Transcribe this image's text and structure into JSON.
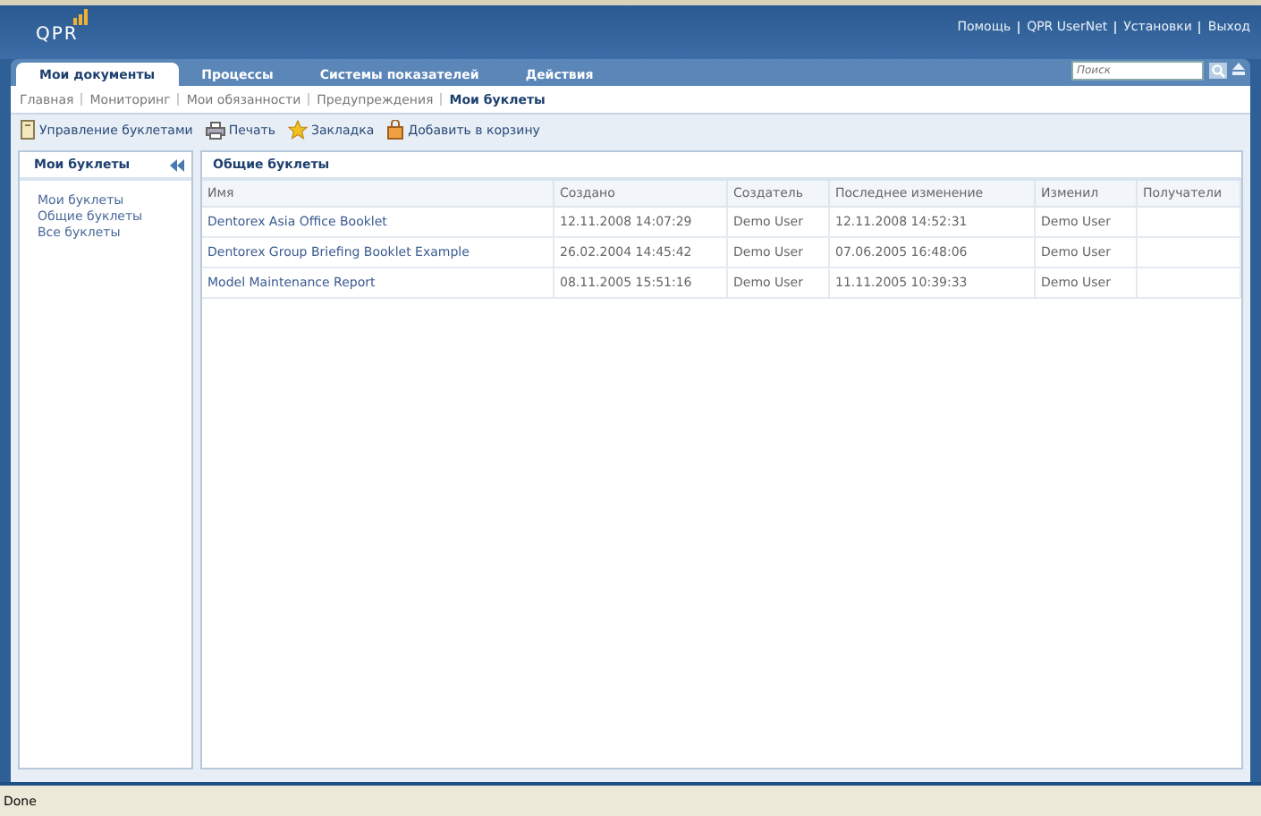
{
  "header": {
    "logo": "QPR",
    "links": [
      "Помощь",
      "QPR UserNet",
      "Установки",
      "Выход"
    ]
  },
  "tabs": [
    {
      "label": "Мои документы",
      "selected": true
    },
    {
      "label": "Процессы",
      "selected": false
    },
    {
      "label": "Системы показателей",
      "selected": false
    },
    {
      "label": "Действия",
      "selected": false
    }
  ],
  "search": {
    "placeholder": "Поиск"
  },
  "subnav": [
    {
      "label": "Главная",
      "selected": false
    },
    {
      "label": "Мониторинг",
      "selected": false
    },
    {
      "label": "Мои обязанности",
      "selected": false
    },
    {
      "label": "Предупреждения",
      "selected": false
    },
    {
      "label": "Мои буклеты",
      "selected": true
    }
  ],
  "toolbar": [
    {
      "label": "Управление буклетами",
      "kind": "manage"
    },
    {
      "label": "Печать",
      "kind": "print"
    },
    {
      "label": "Закладка",
      "kind": "bookmark"
    },
    {
      "label": "Добавить в корзину",
      "kind": "basket"
    }
  ],
  "sidebar": {
    "title": "Мои буклеты",
    "items": [
      "Мои буклеты",
      "Общие буклеты",
      "Все буклеты"
    ]
  },
  "table": {
    "title": "Общие буклеты",
    "columns": [
      "Имя",
      "Создано",
      "Создатель",
      "Последнее изменение",
      "Изменил",
      "Получатели"
    ],
    "rows": [
      [
        "Dentorex Asia Office Booklet",
        "12.11.2008 14:07:29",
        "Demo User",
        "12.11.2008 14:52:31",
        "Demo User",
        ""
      ],
      [
        "Dentorex Group Briefing Booklet Example",
        "26.02.2004 14:45:42",
        "Demo User",
        "07.06.2005 16:48:06",
        "Demo User",
        ""
      ],
      [
        "Model Maintenance Report",
        "08.11.2005 15:51:16",
        "Demo User",
        "11.11.2005 10:39:33",
        "Demo User",
        ""
      ]
    ]
  },
  "status_bar": "Done"
}
